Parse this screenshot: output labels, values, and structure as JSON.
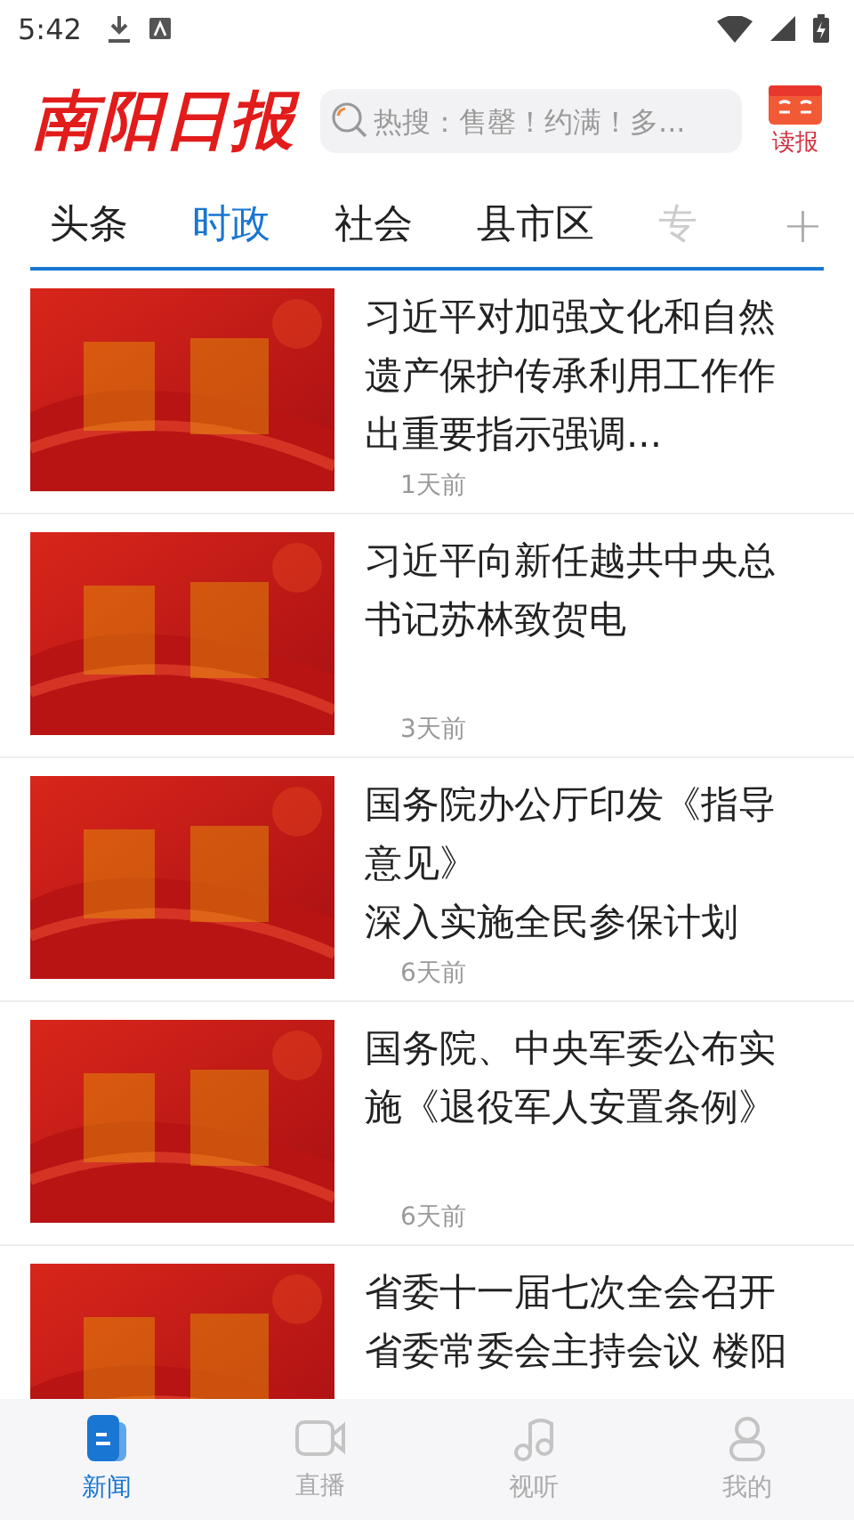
{
  "status_bar": {
    "time": "5:42"
  },
  "header": {
    "logo": "南阳日报",
    "search": {
      "placeholder": "热搜：售罄！约满！多..."
    },
    "read_paper": {
      "label": "读报"
    }
  },
  "tabs": [
    {
      "label": "头条",
      "selected": false
    },
    {
      "label": "时政",
      "selected": true
    },
    {
      "label": "社会",
      "selected": false
    },
    {
      "label": "县市区",
      "selected": false
    },
    {
      "label": "专",
      "selected": false,
      "faded": true
    }
  ],
  "add_tab": "+",
  "news": [
    {
      "title": "习近平对加强文化和自然遗产保护传承利用工作作出重要指示强调...",
      "time": "1天前"
    },
    {
      "title": "习近平向新任越共中央总书记苏林致贺电",
      "time": "3天前"
    },
    {
      "title": "国务院办公厅印发《指导意见》",
      "subtitle": "深入实施全民参保计划",
      "time": "6天前"
    },
    {
      "title": "国务院、中央军委公布实施《退役军人安置条例》",
      "time": "6天前"
    },
    {
      "title": "省委十一届七次全会召开省委常委会主持会议 楼阳"
    }
  ],
  "bottom_nav": [
    {
      "label": "新闻",
      "selected": true
    },
    {
      "label": "直播",
      "selected": false
    },
    {
      "label": "视听",
      "selected": false
    },
    {
      "label": "我的",
      "selected": false
    }
  ]
}
